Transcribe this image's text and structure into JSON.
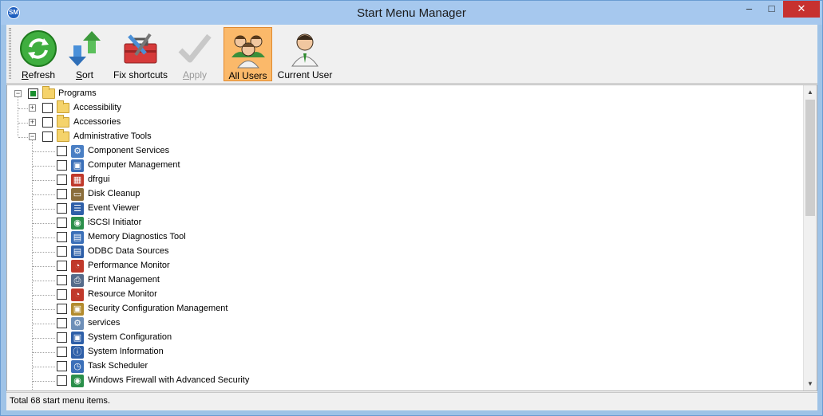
{
  "window": {
    "title": "Start Menu Manager",
    "minimize_glyph": "–",
    "maximize_glyph": "□",
    "close_glyph": "✕"
  },
  "toolbar": {
    "refresh": {
      "hotkey": "R",
      "rest": "efresh",
      "icon": "refresh-icon"
    },
    "sort": {
      "hotkey": "S",
      "rest": "ort",
      "icon": "sort-icon"
    },
    "fix_shortcuts": {
      "label": "Fix shortcuts",
      "icon": "toolbox-icon"
    },
    "apply": {
      "hotkey": "A",
      "rest": "pply",
      "icon": "checkmark-icon"
    },
    "all_users": {
      "label": "All Users",
      "icon": "users-group-icon"
    },
    "current_user": {
      "label": "Current User",
      "icon": "user-icon"
    }
  },
  "tree": {
    "root": {
      "label": "Programs",
      "expanded": true,
      "state": "partial"
    },
    "groups": [
      {
        "label": "Accessibility",
        "expanded": false
      },
      {
        "label": "Accessories",
        "expanded": false
      },
      {
        "label": "Administrative Tools",
        "expanded": true
      }
    ],
    "items": [
      {
        "label": "Component Services",
        "icon": "component-services-icon",
        "color": "#4a7fc4",
        "glyph": "⚙"
      },
      {
        "label": "Computer Management",
        "icon": "computer-management-icon",
        "color": "#3b6fb8",
        "glyph": "▣"
      },
      {
        "label": "dfrgui",
        "icon": "defrag-icon",
        "color": "#c0392b",
        "glyph": "▦"
      },
      {
        "label": "Disk Cleanup",
        "icon": "disk-cleanup-icon",
        "color": "#8a6d3b",
        "glyph": "▭"
      },
      {
        "label": "Event Viewer",
        "icon": "event-viewer-icon",
        "color": "#2e5fa8",
        "glyph": "☰"
      },
      {
        "label": "iSCSI Initiator",
        "icon": "iscsi-initiator-icon",
        "color": "#2a8f4a",
        "glyph": "◉"
      },
      {
        "label": "Memory Diagnostics Tool",
        "icon": "memory-diagnostics-icon",
        "color": "#3b6fb8",
        "glyph": "▤"
      },
      {
        "label": "ODBC Data Sources",
        "icon": "odbc-icon",
        "color": "#2e5fa8",
        "glyph": "▤"
      },
      {
        "label": "Performance Monitor",
        "icon": "performance-monitor-icon",
        "color": "#c0392b",
        "glyph": "◔"
      },
      {
        "label": "Print Management",
        "icon": "print-management-icon",
        "color": "#556b8a",
        "glyph": "⎙"
      },
      {
        "label": "Resource Monitor",
        "icon": "resource-monitor-icon",
        "color": "#c0392b",
        "glyph": "◔"
      },
      {
        "label": "Security Configuration Management",
        "icon": "security-configuration-icon",
        "color": "#b38b2e",
        "glyph": "▣"
      },
      {
        "label": "services",
        "icon": "services-icon",
        "color": "#6d8fb8",
        "glyph": "⚙"
      },
      {
        "label": "System Configuration",
        "icon": "system-configuration-icon",
        "color": "#2e5fa8",
        "glyph": "▣"
      },
      {
        "label": "System Information",
        "icon": "system-information-icon",
        "color": "#2e5fa8",
        "glyph": "ⓘ"
      },
      {
        "label": "Task Scheduler",
        "icon": "task-scheduler-icon",
        "color": "#3b6fb8",
        "glyph": "◷"
      },
      {
        "label": "Windows Firewall with Advanced Security",
        "icon": "firewall-icon",
        "color": "#2a8f4a",
        "glyph": "◉"
      }
    ]
  },
  "scrollbar": {
    "up_glyph": "▲",
    "down_glyph": "▼"
  },
  "status": {
    "text": "Total 68 start menu items."
  },
  "colors": {
    "active_button": "#fbb96a",
    "titlebar": "#a6c8ee",
    "close_button": "#c7312f"
  }
}
